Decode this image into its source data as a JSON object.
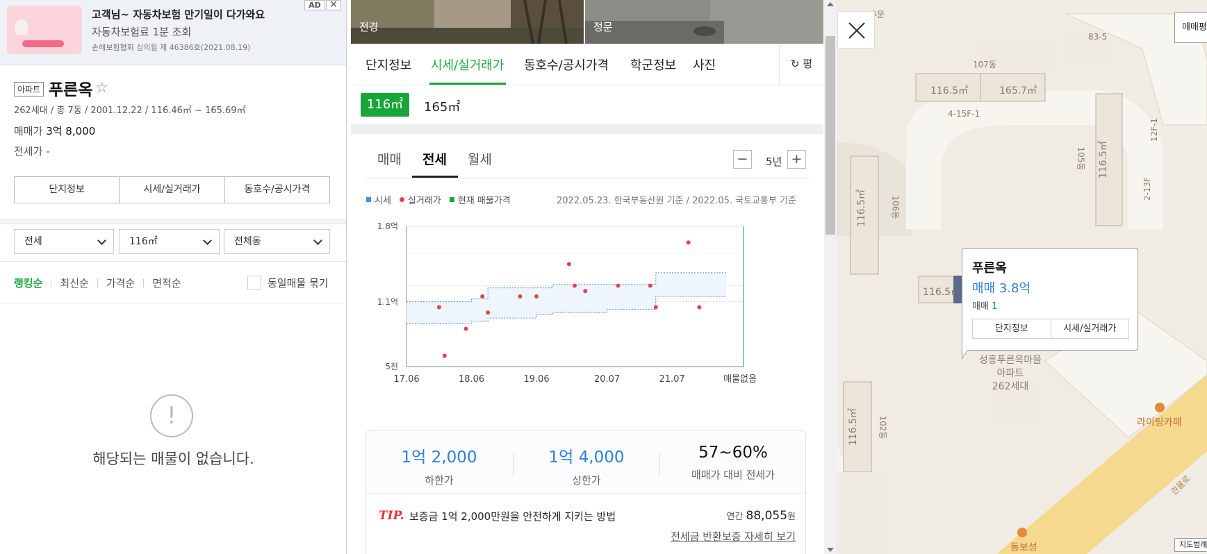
{
  "ad": {
    "title": "고객님~ 자동차보험 만기일이 다가와요",
    "subtitle": "자동차보험료 1분 조회",
    "note": "손해보험협회 심의필 제 46386호(2021.08.19)",
    "badge": "AD",
    "close": "✕"
  },
  "complex": {
    "type": "아파트",
    "name": "푸른옥",
    "star": "☆",
    "meta": "262세대 / 총 7동 / 2001.12.22 / 116.46㎡ ~ 165.69㎡",
    "sale_label": "매매가",
    "sale_value": "3억 8,000",
    "jeonse": "전세가 -"
  },
  "left_tabs": [
    "단지정보",
    "시세/실거래가",
    "동호수/공시가격"
  ],
  "filters": {
    "deal": "전세",
    "area": "116㎡",
    "dong": "전체동"
  },
  "sort": {
    "items": [
      "랭킹순",
      "최신순",
      "가격순",
      "면적순"
    ],
    "group_label": "동일매물 묶기"
  },
  "empty": {
    "icon": "!",
    "message": "해당되는 매물이 없습니다."
  },
  "photos": [
    {
      "label": "전경"
    },
    {
      "label": "정문"
    }
  ],
  "main_tabs": [
    "단지정보",
    "시세/실거래가",
    "동호수/공시가격",
    "학군정보",
    "사진"
  ],
  "unit_toggle": "평",
  "sizes": [
    "116㎡",
    "165㎡"
  ],
  "trade_tabs": [
    "매매",
    "전세",
    "월세"
  ],
  "zoom": {
    "minus": "−",
    "label": "5년",
    "plus": "+"
  },
  "legend": {
    "items": [
      {
        "label": "시세",
        "color": "#4a90d9"
      },
      {
        "label": "실거래가",
        "color": "#e8424a"
      },
      {
        "label": "현재 매물가격",
        "color": "#1aa53a"
      }
    ],
    "basis": "2022.05.23. 한국부동산원 기준 / 2022.05. 국토교통부 기준"
  },
  "chart_data": {
    "type": "scatter",
    "y_ticks": [
      "1.8억",
      "1.1억",
      "5천"
    ],
    "x_ticks": [
      "17.06",
      "18.06",
      "19.06",
      "20.07",
      "21.07"
    ],
    "x_end_label": "매물없음",
    "ylim": [
      5000,
      18000
    ],
    "y_unit": "만원",
    "band_color": "#4a90d9",
    "band": [
      {
        "x": "2017-06",
        "low": 9000,
        "high": 11000
      },
      {
        "x": "2018-06",
        "low": 9200,
        "high": 11300
      },
      {
        "x": "2018-09",
        "low": 9500,
        "high": 12300
      },
      {
        "x": "2019-06",
        "low": 9800,
        "high": 12300
      },
      {
        "x": "2019-09",
        "low": 10000,
        "high": 12600
      },
      {
        "x": "2020-07",
        "low": 10300,
        "high": 12600
      },
      {
        "x": "2021-01",
        "low": 10300,
        "high": 12600
      },
      {
        "x": "2021-04",
        "low": 11500,
        "high": 13700
      },
      {
        "x": "2022-05",
        "low": 11500,
        "high": 13700
      }
    ],
    "points": [
      {
        "x": "2017-12",
        "y": 10500
      },
      {
        "x": "2018-01",
        "y": 6000
      },
      {
        "x": "2018-05",
        "y": 8500
      },
      {
        "x": "2018-08",
        "y": 11500
      },
      {
        "x": "2018-09",
        "y": 10000
      },
      {
        "x": "2019-03",
        "y": 11500
      },
      {
        "x": "2019-06",
        "y": 11500
      },
      {
        "x": "2019-12",
        "y": 14500
      },
      {
        "x": "2020-01",
        "y": 12500
      },
      {
        "x": "2020-03",
        "y": 12000
      },
      {
        "x": "2020-09",
        "y": 12500
      },
      {
        "x": "2021-03",
        "y": 12500
      },
      {
        "x": "2021-04",
        "y": 10500
      },
      {
        "x": "2021-10",
        "y": 16500
      },
      {
        "x": "2021-12",
        "y": 10500
      }
    ],
    "point_color": "#e8424a",
    "current_marker_color": "#1aa53a"
  },
  "summary": {
    "low_value": "1억 2,000",
    "low_label": "하한가",
    "high_value": "1억 4,000",
    "high_label": "상한가",
    "ratio_value": "57~60%",
    "ratio_label": "매매가 대비 전세가",
    "tip": "TIP.",
    "tip_text": "보증금 1억 2,000만원을 안전하게 지키는 방법",
    "annual_label": "연간",
    "annual_value": "88,055",
    "annual_unit": "원",
    "link": "전세금 반환보증 자세히 보기"
  },
  "map": {
    "popup": {
      "name": "푸른옥",
      "price": "매매 3.8억",
      "count_label": "매매",
      "count": "1",
      "buttons": [
        "단지정보",
        "시세/실거래가"
      ]
    },
    "labels": [
      "후문",
      "83-5",
      "107동",
      "116.5㎡",
      "165.7㎡",
      "4-15F-1",
      "12F-1",
      "106동",
      "105동",
      "116.5㎡",
      "116.5㎡",
      "116.5㎡",
      "2-13F",
      "102동",
      "116.5㎡",
      "라이팅카페",
      "동보성",
      "권율로"
    ],
    "complex_label": "성흥푸른옥마을\n아파트\n262세대",
    "right_btn": "매매평",
    "scale": "지도범례"
  }
}
